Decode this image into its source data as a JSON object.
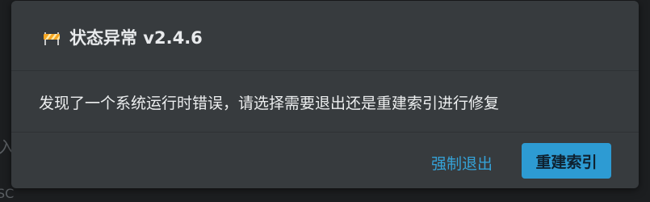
{
  "background": {
    "fragment_1": "入",
    "fragment_2": "SC"
  },
  "dialog": {
    "icon": "construction-barrier-icon",
    "title": "状态异常 v2.4.6",
    "message": "发现了一个系统运行时错误，请选择需要退出还是重建索引进行修复",
    "buttons": {
      "force_quit": "强制退出",
      "rebuild_index": "重建索引"
    }
  },
  "colors": {
    "dialog_bg": "#373b3e",
    "accent": "#2d9bd3",
    "link": "#35a2d7",
    "icon_orange": "#f6a623",
    "icon_light": "#ffe9a8"
  }
}
